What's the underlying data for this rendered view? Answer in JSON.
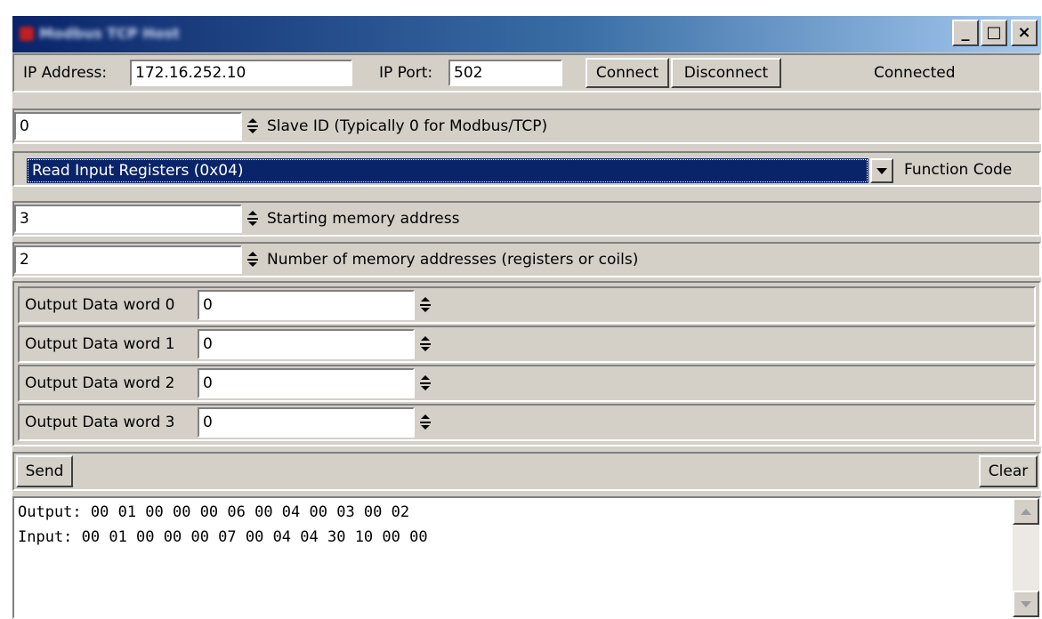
{
  "window": {
    "title": "Modbus TCP Host",
    "minimize_glyph": "_",
    "maximize_glyph": "□",
    "close_glyph": "×"
  },
  "connection": {
    "ip_label": "IP Address:",
    "ip_value": "172.16.252.10",
    "port_label": "IP Port:",
    "port_value": "502",
    "connect_label": "Connect",
    "disconnect_label": "Disconnect",
    "status": "Connected"
  },
  "slave": {
    "value": "0",
    "label": "Slave ID (Typically 0 for Modbus/TCP)"
  },
  "function": {
    "selected": "Read Input Registers (0x04)",
    "label": "Function Code"
  },
  "start_address": {
    "value": "3",
    "label": "Starting memory address"
  },
  "count": {
    "value": "2",
    "label": "Number of memory addresses (registers or coils)"
  },
  "output_words": [
    {
      "label": "Output Data word 0",
      "value": "0"
    },
    {
      "label": "Output Data word 1",
      "value": "0"
    },
    {
      "label": "Output Data word 2",
      "value": "0"
    },
    {
      "label": "Output Data word 3",
      "value": "0"
    }
  ],
  "actions": {
    "send_label": "Send",
    "clear_label": "Clear"
  },
  "log": {
    "line1": "Output: 00 01 00 00 00 06 00 04 00 03 00 02",
    "line2": "Input: 00 01 00 00 00 07 00 04 04 30 10 00 00"
  },
  "colors": {
    "titlebar_start": "#0a246a",
    "titlebar_end": "#a6caf0",
    "selection": "#0a246a",
    "face": "#d4d0c8"
  },
  "icons": [
    "minimize-icon",
    "maximize-icon",
    "close-icon",
    "spinner-icon",
    "dropdown-arrow-icon",
    "scroll-up-icon",
    "scroll-down-icon"
  ]
}
